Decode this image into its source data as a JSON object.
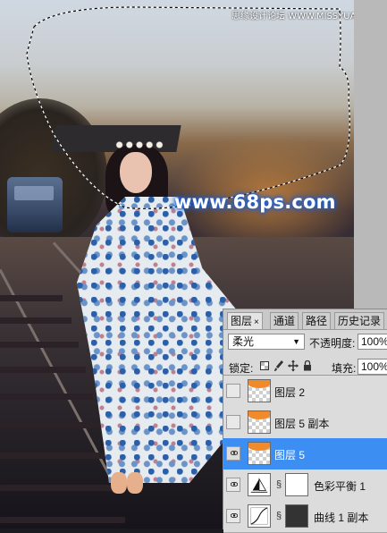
{
  "watermark": "www.68ps.com",
  "site_credit": "思缘设计论坛 WWW.MISSYUAN.COM",
  "colors": {
    "selected_layer": "#3d8ef2",
    "panel_bg": "#d9d9d9",
    "watermark_glow": "#1b5fd0"
  },
  "layers_panel": {
    "tabs": [
      {
        "label": "图层",
        "close": "×"
      },
      {
        "label": "通道"
      },
      {
        "label": "路径"
      },
      {
        "label": "历史记录"
      }
    ],
    "blend_mode": "柔光",
    "opacity_label": "不透明度:",
    "opacity_value": "100%",
    "lock_label": "锁定:",
    "lock_icons": [
      "lock-transparent-icon",
      "brush-icon",
      "move-icon",
      "lock-icon"
    ],
    "fill_label": "填充:",
    "fill_value": "100%",
    "layers": [
      {
        "name": "图层 2",
        "visible": false,
        "selected": false,
        "thumb": "orange"
      },
      {
        "name": "图层 5 副本",
        "visible": false,
        "selected": false,
        "thumb": "orange"
      },
      {
        "name": "图层 5",
        "visible": true,
        "selected": true,
        "thumb": "orange"
      },
      {
        "name": "色彩平衡 1",
        "visible": true,
        "selected": false,
        "thumb": "adjustment-balance"
      },
      {
        "name": "曲线 1 副本",
        "visible": true,
        "selected": false,
        "thumb": "adjustment-curves"
      }
    ]
  }
}
